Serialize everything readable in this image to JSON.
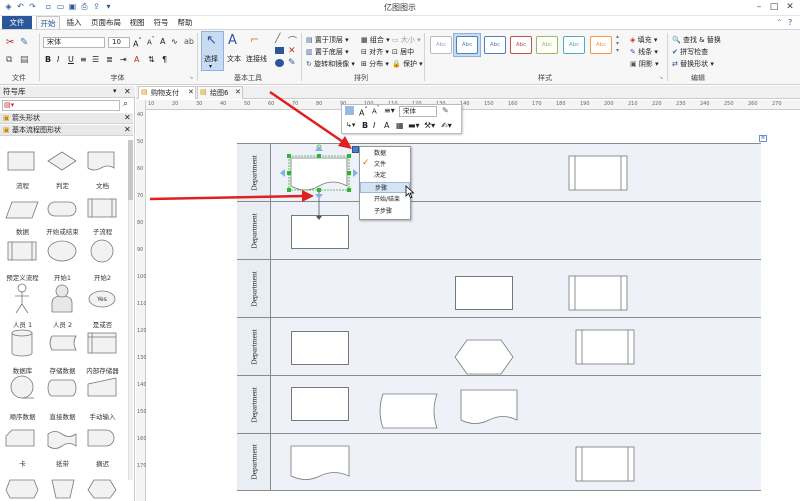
{
  "app": {
    "title": "亿图图示",
    "window_controls": [
      "minimize-icon",
      "maximize-icon",
      "close-icon"
    ]
  },
  "menu": {
    "tabs": [
      "文件",
      "开始",
      "插入",
      "页面布局",
      "视图",
      "符号",
      "帮助"
    ],
    "active_index": 1
  },
  "ribbon": {
    "groups": [
      "文件",
      "字体",
      "基本工具",
      "排列",
      "样式",
      "编辑"
    ],
    "font": {
      "family": "宋体",
      "size": "10"
    },
    "tools": {
      "select": "选择",
      "text": "文本",
      "connector": "连接线"
    },
    "arrange": {
      "bring_front": "置于顶层",
      "send_back": "置于底层",
      "rotate": "旋转和镜像",
      "group": "组合",
      "align": "对齐",
      "distribute": "分布",
      "size": "大小",
      "center": "居中",
      "protect": "保护"
    },
    "style": {
      "fill": "填充",
      "line": "线条",
      "shadow": "阴影",
      "swatch_text": "Abc",
      "swatch_colors": [
        "#8fa8c8",
        "#4f81bd",
        "#4f81bd",
        "#c0504d",
        "#9bbb59",
        "#4bacc6",
        "#f79646"
      ]
    },
    "edit": {
      "find_replace": "查找 & 替换",
      "spell_check": "拼写检查",
      "replace_shape": "替换形状"
    }
  },
  "panel": {
    "title": "符号库",
    "libraries": [
      "箭头形状",
      "基本流程图形状"
    ],
    "shapes": [
      "流程",
      "判定",
      "文档",
      "数据",
      "开始或结束",
      "子流程",
      "预定义流程",
      "开始1",
      "开始2",
      "人员 1",
      "人员 2",
      "是或否",
      "数据库",
      "存储数据",
      "内部存储器",
      "顺序数据",
      "直接数据",
      "手动输入",
      "卡",
      "纸带",
      "摘迟"
    ],
    "yes_text": "Yes"
  },
  "doc_tabs": [
    "购物支付",
    "绘图6"
  ],
  "ruler": {
    "h": [
      "10",
      "20",
      "30",
      "40",
      "50",
      "60",
      "70",
      "80",
      "90",
      "100",
      "110",
      "120",
      "130",
      "140",
      "150",
      "160",
      "170",
      "180",
      "190",
      "200",
      "210",
      "220",
      "230",
      "240",
      "250",
      "260",
      "270"
    ],
    "v": [
      "40",
      "50",
      "60",
      "70",
      "80",
      "90",
      "100",
      "110",
      "120",
      "130",
      "140",
      "150",
      "160",
      "170"
    ]
  },
  "lanes": [
    "Department",
    "Department",
    "Department",
    "Department",
    "Department",
    "Department"
  ],
  "mini_toolbar": {
    "font": "宋体"
  },
  "context_menu": {
    "items": [
      "数据",
      "文件",
      "决定",
      "步骤",
      "开始/结束",
      "子步骤"
    ],
    "checked_index": 1,
    "hover_index": 3
  }
}
